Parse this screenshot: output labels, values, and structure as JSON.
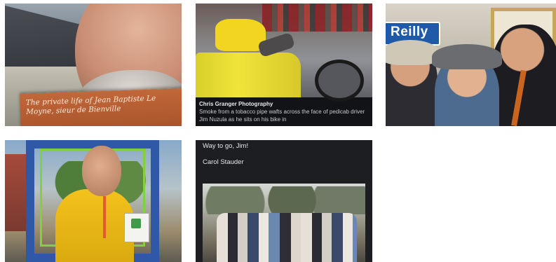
{
  "tiles": [
    {
      "kind": "photo",
      "booklet_text": "The private life of Jean Baptiste Le Moyne, sieur de Bienville"
    },
    {
      "kind": "post-photo",
      "caption_title": "Chris Granger Photography",
      "caption_body": "Smoke from a tobacco pipe wafts across the face of pedicab driver Jim Nuzula as he sits on his bike in"
    },
    {
      "kind": "photo",
      "sign_text": "Reilly"
    },
    {
      "kind": "photo"
    },
    {
      "kind": "post-text-photo",
      "line1": "Way to go, Jim!",
      "line2": "Carol Stauder"
    }
  ]
}
